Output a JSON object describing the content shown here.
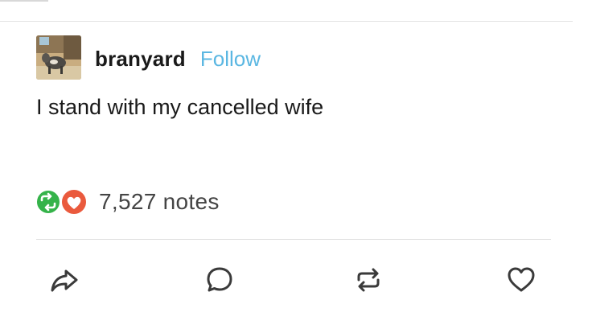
{
  "post": {
    "username": "branyard",
    "follow_label": "Follow",
    "body_text": "I stand with my cancelled wife",
    "notes_count": "7,527 notes",
    "avatar_icon": "goat-photo-avatar",
    "reblog_badge_color": "#35b34a",
    "like_badge_color": "#ea5a3d"
  },
  "actions": {
    "share_icon": "share-arrow-icon",
    "reply_icon": "reply-bubble-icon",
    "reblog_icon": "reblog-icon",
    "like_icon": "heart-icon"
  },
  "colors": {
    "follow_link": "#5bb7e2",
    "text": "#1a1a1a",
    "icon_stroke": "#3a3a3a"
  }
}
